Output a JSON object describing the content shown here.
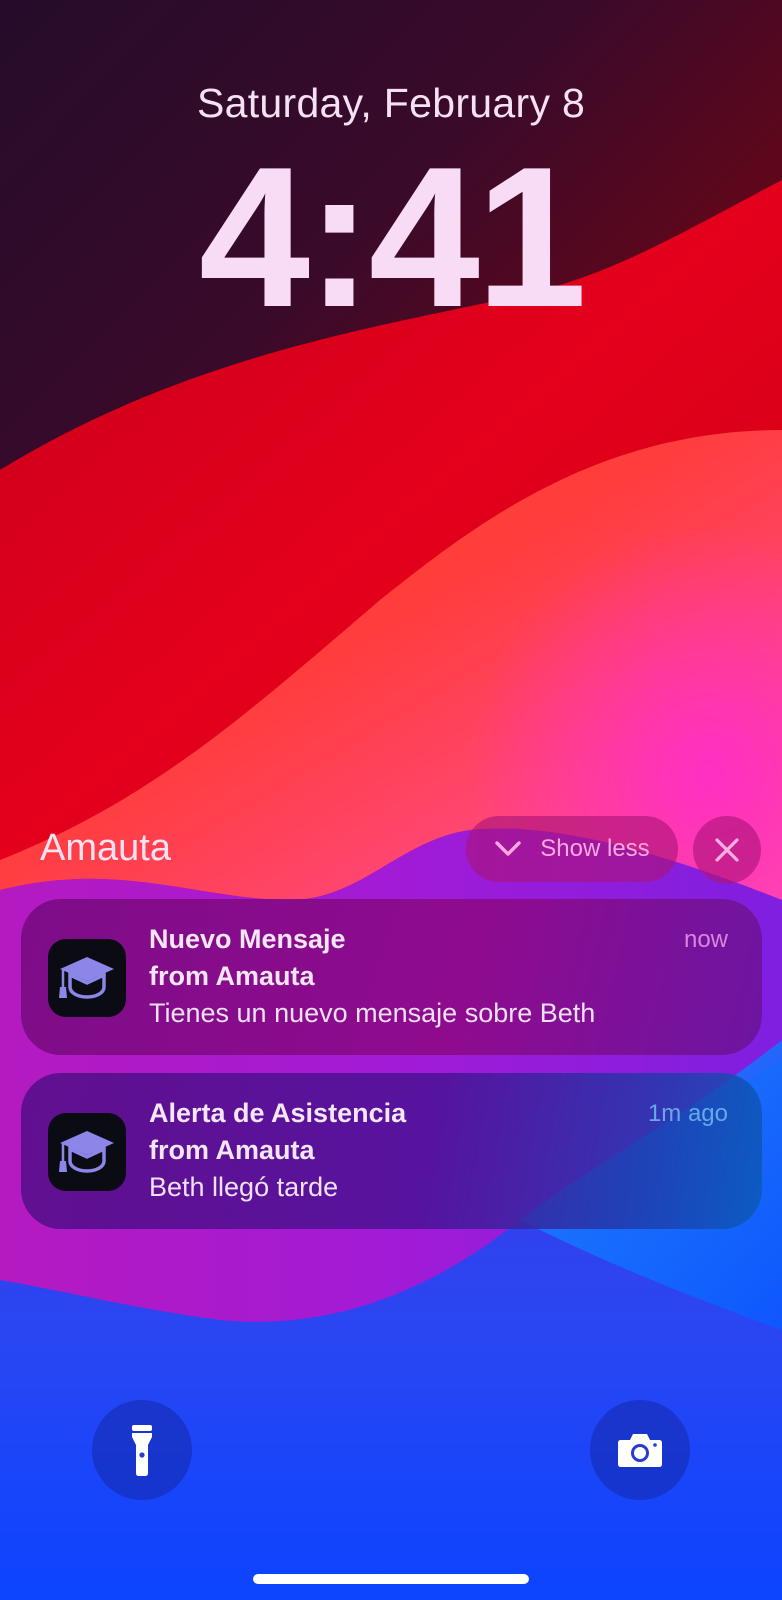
{
  "lockscreen": {
    "date": "Saturday, February 8",
    "time": "4:41"
  },
  "notification_group": {
    "app_name": "Amauta",
    "show_less_label": "Show less",
    "notifications": [
      {
        "title": "Nuevo Mensaje",
        "source": "from Amauta",
        "body": "Tienes un nuevo mensaje sobre Beth",
        "time": "now",
        "icon": "graduation-cap-icon"
      },
      {
        "title": "Alerta de Asistencia",
        "source": "from Amauta",
        "body": "Beth llegó tarde",
        "time": "1m ago",
        "icon": "graduation-cap-icon"
      }
    ]
  },
  "quick_actions": {
    "left_icon": "flashlight-icon",
    "right_icon": "camera-icon"
  },
  "colors": {
    "icon_accent": "#8b86e8",
    "wallpaper_red": "#e3001e",
    "wallpaper_blue": "#1238ff"
  }
}
